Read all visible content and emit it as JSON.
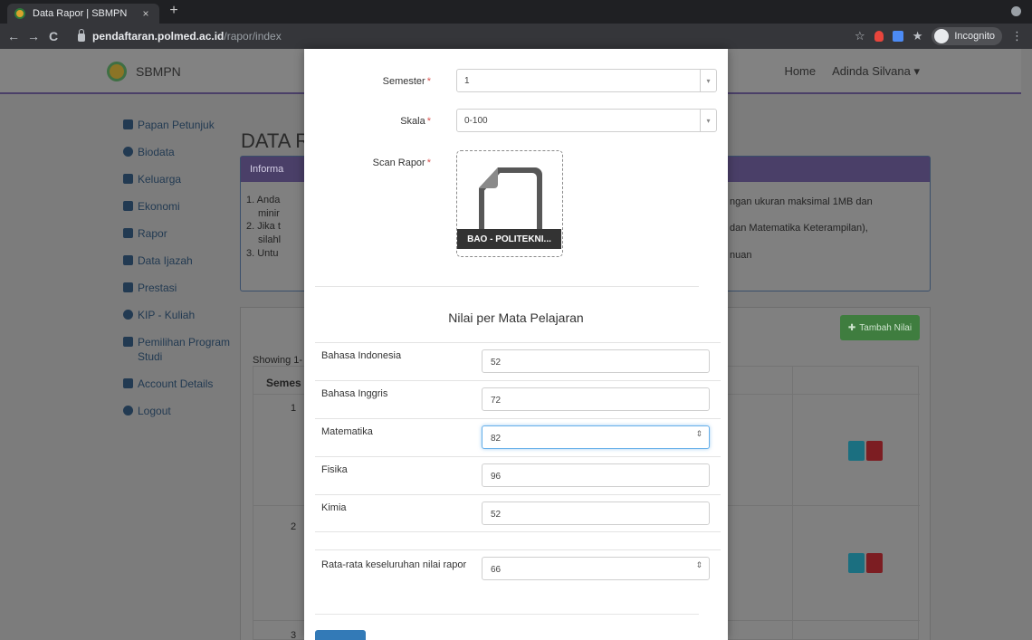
{
  "browser": {
    "tab_title": "Data Rapor | SBMPN",
    "tab_close": "×",
    "new_tab": "+",
    "back": "←",
    "forward": "→",
    "reload": "C",
    "url_host": "pendaftaran.polmed.ac.id",
    "url_path": "/rapor/index",
    "bookmark_star": "☆",
    "extensions_icon": "★",
    "incognito_label": "Incognito",
    "menu_dots": "⋮"
  },
  "navbar": {
    "brand": "SBMPN",
    "links": [
      "Home",
      "Adinda Silvana ▾"
    ]
  },
  "sidebar": {
    "items": [
      {
        "label": "Papan Petunjuk"
      },
      {
        "label": "Biodata"
      },
      {
        "label": "Keluarga"
      },
      {
        "label": "Ekonomi"
      },
      {
        "label": "Rapor"
      },
      {
        "label": "Data Ijazah"
      },
      {
        "label": "Prestasi"
      },
      {
        "label": "KIP - Kuliah"
      },
      {
        "label": "Pemilihan Program Studi"
      },
      {
        "label": "Account Details"
      },
      {
        "label": "Logout"
      }
    ]
  },
  "background": {
    "heading": "DATA R",
    "info_header": "Informa",
    "info_lines": [
      "1. Anda",
      "minir",
      "2. Jika t",
      "silahl",
      "3. Untu",
      "ngan ukuran maksimal 1MB dan",
      "dan Matematika Keterampilan),",
      "nuan"
    ],
    "showing": "Showing 1-",
    "col_semester": "Semes",
    "row_numbers": [
      "1",
      "2",
      "3"
    ],
    "add_button": "Tambah Nilai",
    "add_icon": "✚",
    "view_icon": "◉",
    "delete_icon": "▮"
  },
  "modal": {
    "semester_label": "Semester",
    "semester_value": "1",
    "skala_label": "Skala",
    "skala_value": "0-100",
    "scan_label": "Scan Rapor",
    "required_mark": "*",
    "caret": "▾",
    "file_name": "BAO - POLITEKNI...",
    "section_title": "Nilai per Mata Pelajaran",
    "subjects": [
      {
        "label": "Bahasa Indonesia",
        "value": "52"
      },
      {
        "label": "Bahasa Inggris",
        "value": "72"
      },
      {
        "label": "Matematika",
        "value": "82"
      },
      {
        "label": "Fisika",
        "value": "96"
      },
      {
        "label": "Kimia",
        "value": "52"
      }
    ],
    "average_label": "Rata-rata keseluruhan nilai rapor",
    "average_value": "66",
    "spin_glyph": "⇕"
  }
}
